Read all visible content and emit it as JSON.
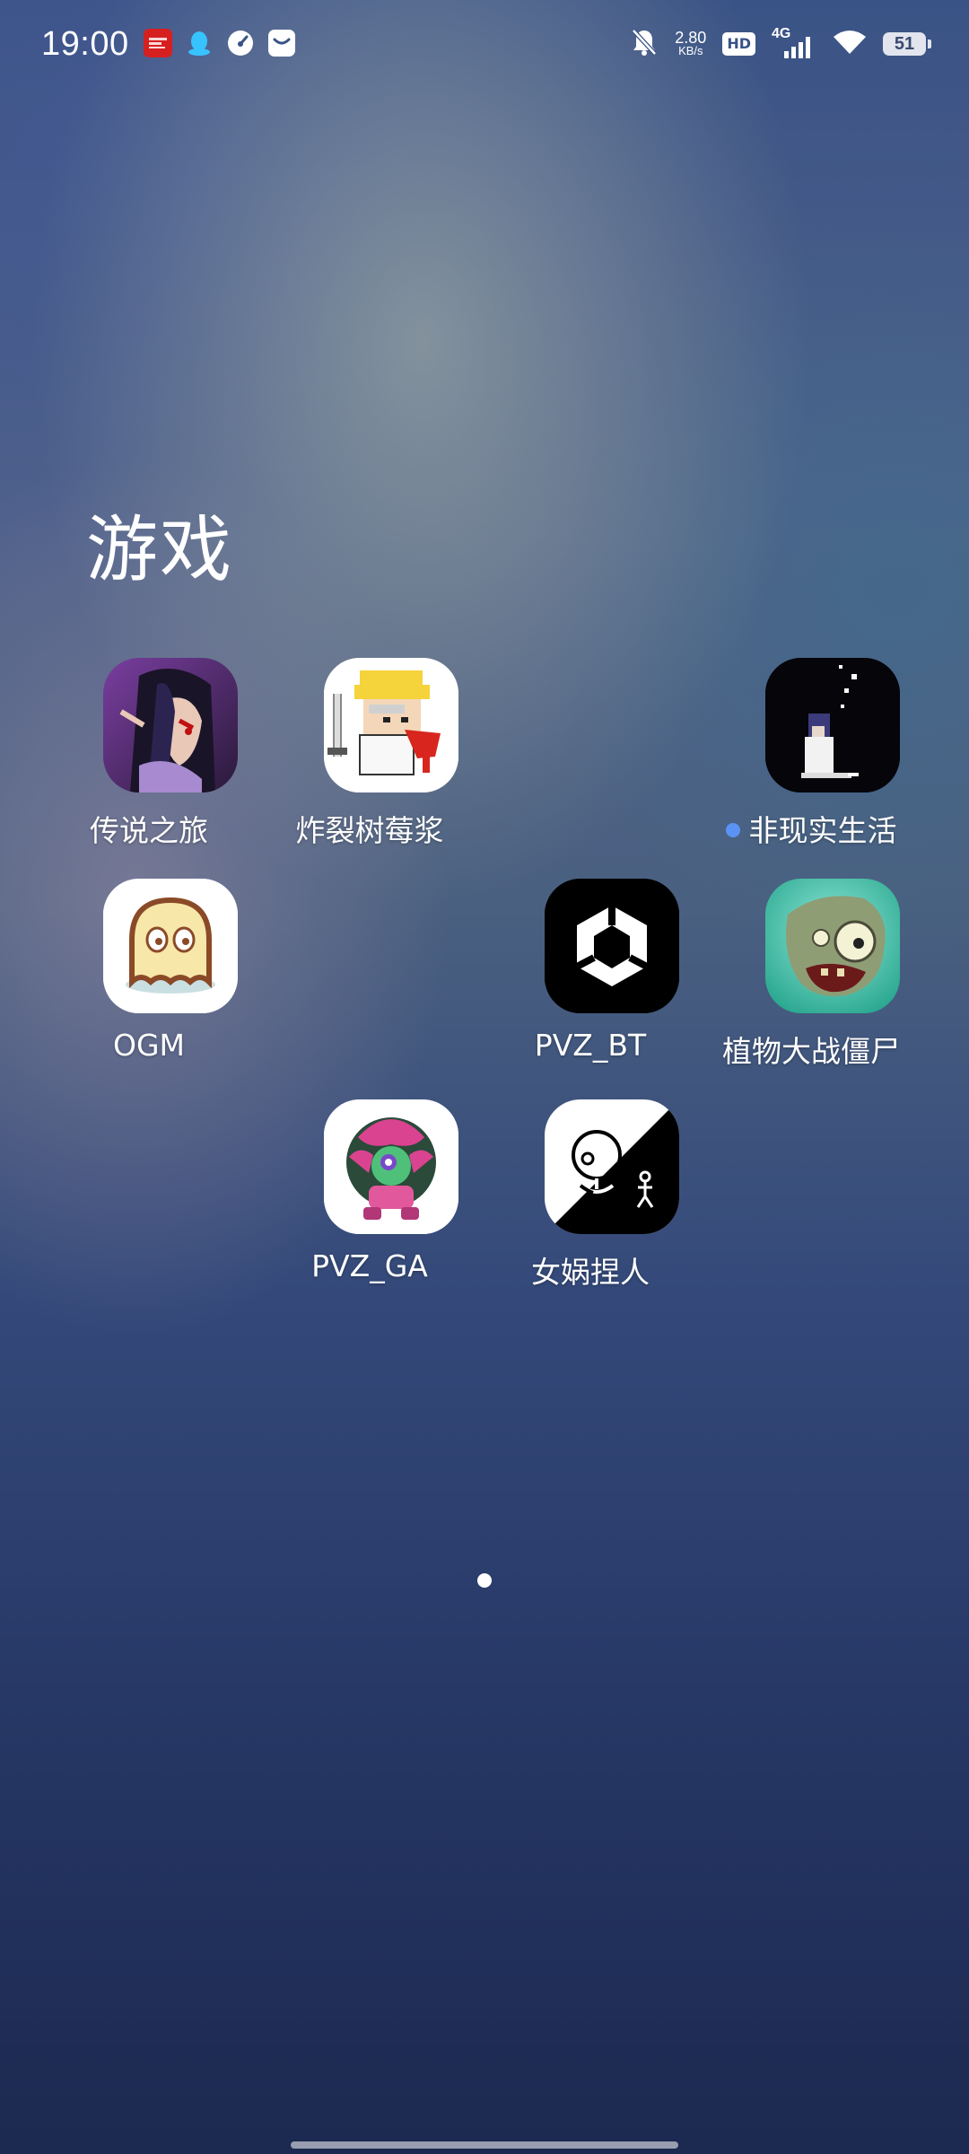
{
  "status_bar": {
    "time": "19:00",
    "net_speed_value": "2.80",
    "net_speed_unit": "KB/s",
    "hd_label": "HD",
    "network_type": "4G",
    "battery_level": "51",
    "notification_icons": [
      "news-app-icon",
      "qq-icon",
      "speedometer-icon",
      "mail-icon"
    ]
  },
  "folder": {
    "title": "游戏",
    "apps": [
      {
        "name": "传说之旅",
        "icon": "legend-journey-icon",
        "new": false
      },
      {
        "name": "炸裂树莓浆",
        "icon": "raspberry-game-icon",
        "new": false
      },
      {
        "name": "非现实生活",
        "icon": "unreal-life-icon",
        "new": true
      },
      {
        "name": "OGM",
        "icon": "ghost-icon",
        "new": false
      },
      {
        "name": "PVZ_BT",
        "icon": "unity-icon",
        "new": false
      },
      {
        "name": "植物大战僵尸",
        "icon": "zombie-icon",
        "new": false
      },
      {
        "name": "PVZ_GA",
        "icon": "flower-monster-icon",
        "new": false
      },
      {
        "name": "女娲捏人",
        "icon": "figure-drawing-icon",
        "new": false
      }
    ]
  },
  "page_indicator": {
    "pages": 1,
    "current": 1
  }
}
